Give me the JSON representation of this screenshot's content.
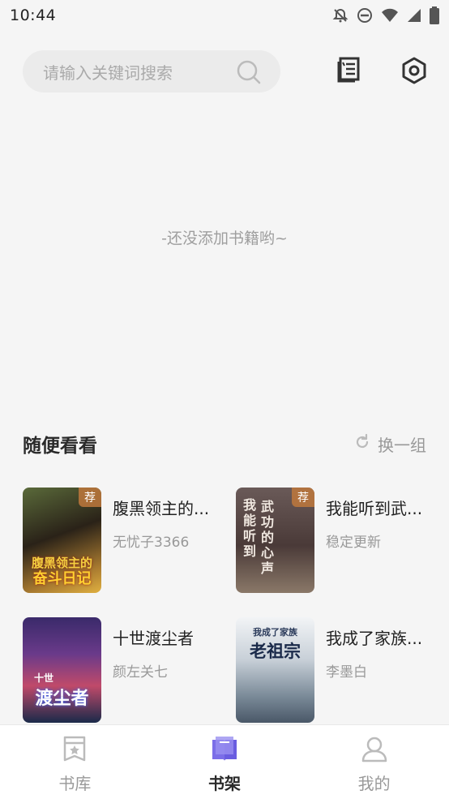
{
  "status_bar": {
    "time": "10:44",
    "icons": [
      "notifications-off-icon",
      "do-not-disturb-icon",
      "wifi-icon",
      "signal-icon",
      "battery-icon"
    ]
  },
  "header": {
    "search_placeholder": "请输入关键词搜索",
    "icons": [
      "search-icon",
      "book-list-icon",
      "settings-icon"
    ]
  },
  "shelf": {
    "empty_text": "-还没添加书籍哟~"
  },
  "recommend": {
    "title": "随便看看",
    "refresh_label": "换一组",
    "books": [
      {
        "title": "腹黑领主的...",
        "author": "无忧子3366",
        "badge": "荐",
        "cover_text": "腹黑领主的奋斗日记",
        "cover_colors": [
          "#3a4a2a",
          "#c8a040"
        ]
      },
      {
        "title": "我能听到武...",
        "author": "稳定更新",
        "badge": "荐",
        "cover_text": "我能听到武功的心声",
        "cover_colors": [
          "#5a4a48",
          "#8a7a6a"
        ]
      },
      {
        "title": "十世渡尘者",
        "author": "颜左关七",
        "badge": "",
        "cover_text": "十世渡尘者",
        "cover_colors": [
          "#2a2a6a",
          "#e04a7a"
        ]
      },
      {
        "title": "我成了家族...",
        "author": "李墨白",
        "badge": "",
        "cover_text": "我成了家族老祖宗",
        "cover_colors": [
          "#e8eef2",
          "#5a6a7a"
        ]
      }
    ]
  },
  "bottom_nav": {
    "items": [
      {
        "label": "书库",
        "icon": "library-icon",
        "active": false
      },
      {
        "label": "书架",
        "icon": "bookshelf-icon",
        "active": true
      },
      {
        "label": "我的",
        "icon": "profile-icon",
        "active": false
      }
    ]
  }
}
